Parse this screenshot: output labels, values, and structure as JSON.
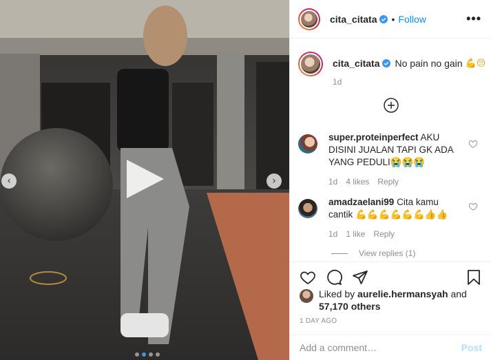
{
  "post": {
    "username": "cita_citata",
    "follow_label": "Follow",
    "separator": "•",
    "more_label": "•••",
    "caption_text": "No pain no gain",
    "caption_emoji": "💪😔",
    "caption_time": "1d"
  },
  "media": {
    "carousel_prev": "‹",
    "carousel_next": "›",
    "dots": 4,
    "active_dot": 1
  },
  "comments": [
    {
      "username": "super.proteinperfect",
      "text": "AKU DISINI JUALAN TAPI GK ADA YANG PEDULI😭😭😭",
      "time": "1d",
      "likes": "4 likes",
      "reply": "Reply"
    },
    {
      "username": "amadzaelani99",
      "text": "Cita kamu cantik 💪💪💪💪💪💪👍👍",
      "time": "1d",
      "likes": "1 like",
      "reply": "Reply"
    }
  ],
  "view_replies": "View replies (1)",
  "likes": {
    "prefix": "Liked by",
    "user": "aurelie.hermansyah",
    "and": "and",
    "others": "57,170 others"
  },
  "date": "1 DAY AGO",
  "add_comment": {
    "placeholder": "Add a comment…",
    "post_label": "Post"
  },
  "colors": {
    "accent": "#0095f6",
    "muted": "#8e8e8e",
    "post_disabled": "#b2dffc"
  }
}
